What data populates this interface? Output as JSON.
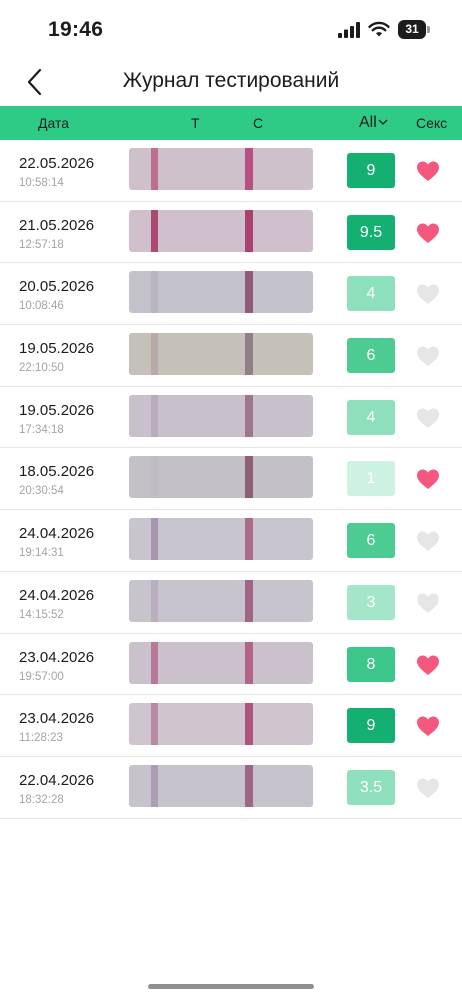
{
  "status_bar": {
    "time": "19:46",
    "battery_level": "31",
    "icons": [
      "signal-icon",
      "wifi-icon",
      "battery-icon"
    ]
  },
  "nav": {
    "back_icon": "chevron-left-icon",
    "title": "Журнал тестирований"
  },
  "table_header": {
    "date": "Дата",
    "t": "Т",
    "c": "С",
    "filter": "All",
    "filter_icon": "chevron-down-icon",
    "sex": "Секс"
  },
  "colors": {
    "header_green": "#2ecb86",
    "heart_active": "#f5587e",
    "heart_inactive": "#e6e6e6",
    "score_high": "#13b072",
    "score_mid": "#4ccc93",
    "score_low": "#8ee0bd",
    "score_very_low": "#cdf2e2"
  },
  "tests": [
    {
      "date": "22.05.2026",
      "time": "10:58:14",
      "score": "9",
      "sex": true,
      "score_color": "#13b072",
      "strip": {
        "bg": "#cec1cc",
        "t_line": "#be6f90",
        "c_line": "#b74f80"
      }
    },
    {
      "date": "21.05.2026",
      "time": "12:57:18",
      "score": "9.5",
      "sex": true,
      "score_color": "#13b072",
      "strip": {
        "bg": "#d0bfcc",
        "t_line": "#ac4a72",
        "c_line": "#a8416f"
      }
    },
    {
      "date": "20.05.2026",
      "time": "10:08:46",
      "score": "4",
      "sex": false,
      "score_color": "#8ee0bd",
      "strip": {
        "bg": "#c3c1ca",
        "t_line": "#b9b4c0",
        "c_line": "#8f5b78"
      }
    },
    {
      "date": "19.05.2026",
      "time": "22:10:50",
      "score": "6",
      "sex": false,
      "score_color": "#4ccc93",
      "strip": {
        "bg": "#c6c1b8",
        "t_line": "#b7a9a9",
        "c_line": "#907f84"
      }
    },
    {
      "date": "19.05.2026",
      "time": "17:34:18",
      "score": "4",
      "sex": false,
      "score_color": "#8ee0bd",
      "strip": {
        "bg": "#c8c1cb",
        "t_line": "#b8adbd",
        "c_line": "#a0768e"
      }
    },
    {
      "date": "18.05.2026",
      "time": "20:30:54",
      "score": "1",
      "sex": true,
      "score_color": "#cdf2e2",
      "strip": {
        "bg": "#c3c1c7",
        "t_line": "#c0bcc4",
        "c_line": "#8f5f78"
      }
    },
    {
      "date": "24.04.2026",
      "time": "19:14:31",
      "score": "6",
      "sex": false,
      "score_color": "#4ccc93",
      "strip": {
        "bg": "#c9c5cf",
        "t_line": "#a796ad",
        "c_line": "#ab6b8b"
      }
    },
    {
      "date": "24.04.2026",
      "time": "14:15:52",
      "score": "3",
      "sex": false,
      "score_color": "#a3e6c9",
      "strip": {
        "bg": "#c8c4ce",
        "t_line": "#b8aebf",
        "c_line": "#a26485"
      }
    },
    {
      "date": "23.04.2026",
      "time": "19:57:00",
      "score": "8",
      "sex": true,
      "score_color": "#3cc689",
      "strip": {
        "bg": "#cbc1cc",
        "t_line": "#b7789a",
        "c_line": "#b16488"
      }
    },
    {
      "date": "23.04.2026",
      "time": "11:28:23",
      "score": "9",
      "sex": true,
      "score_color": "#13b072",
      "strip": {
        "bg": "#cfc5ce",
        "t_line": "#b98aa3",
        "c_line": "#b0547e"
      }
    },
    {
      "date": "22.04.2026",
      "time": "18:32:28",
      "score": "3.5",
      "sex": false,
      "score_color": "#8ee0bd",
      "strip": {
        "bg": "#c7c3cd",
        "t_line": "#ad9db3",
        "c_line": "#9f6584"
      }
    }
  ]
}
